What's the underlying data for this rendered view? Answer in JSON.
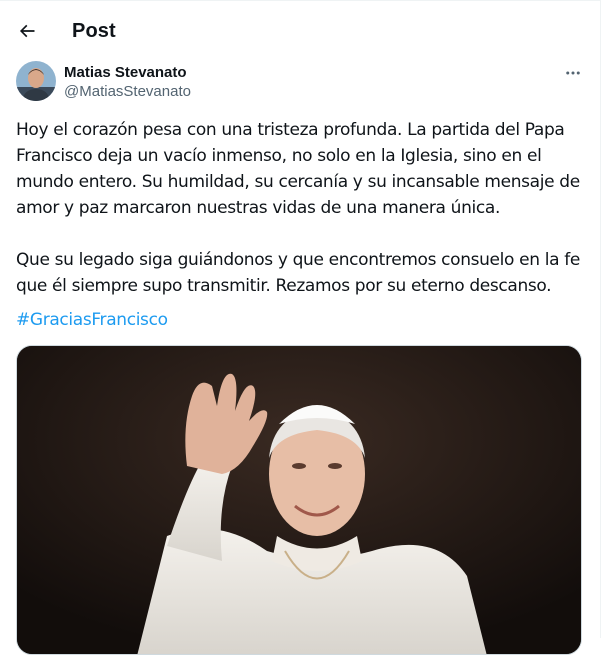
{
  "header": {
    "title": "Post",
    "back_icon": "arrow-left-icon"
  },
  "author": {
    "display_name": "Matias Stevanato",
    "handle": "@MatiasStevanato",
    "avatar_icon": "user-avatar",
    "more_icon": "more-horizontal-icon"
  },
  "tweet": {
    "paragraphs": [
      "Hoy el corazón pesa con una tristeza profunda. La partida del Papa Francisco deja un vacío inmenso, no solo en la Iglesia, sino en el mundo entero. Su humildad, su cercanía y su incansable mensaje de amor y paz marcaron nuestras vidas de una manera única.",
      "Que su legado siga guiándonos y que encontremos consuelo en la fe que él siempre supo transmitir.  Rezamos por su eterno descanso."
    ],
    "hashtag": "#GraciasFrancisco"
  },
  "colors": {
    "text": "#0f1419",
    "secondary": "#536471",
    "link": "#1d9bf0",
    "border": "#cfd9de"
  }
}
